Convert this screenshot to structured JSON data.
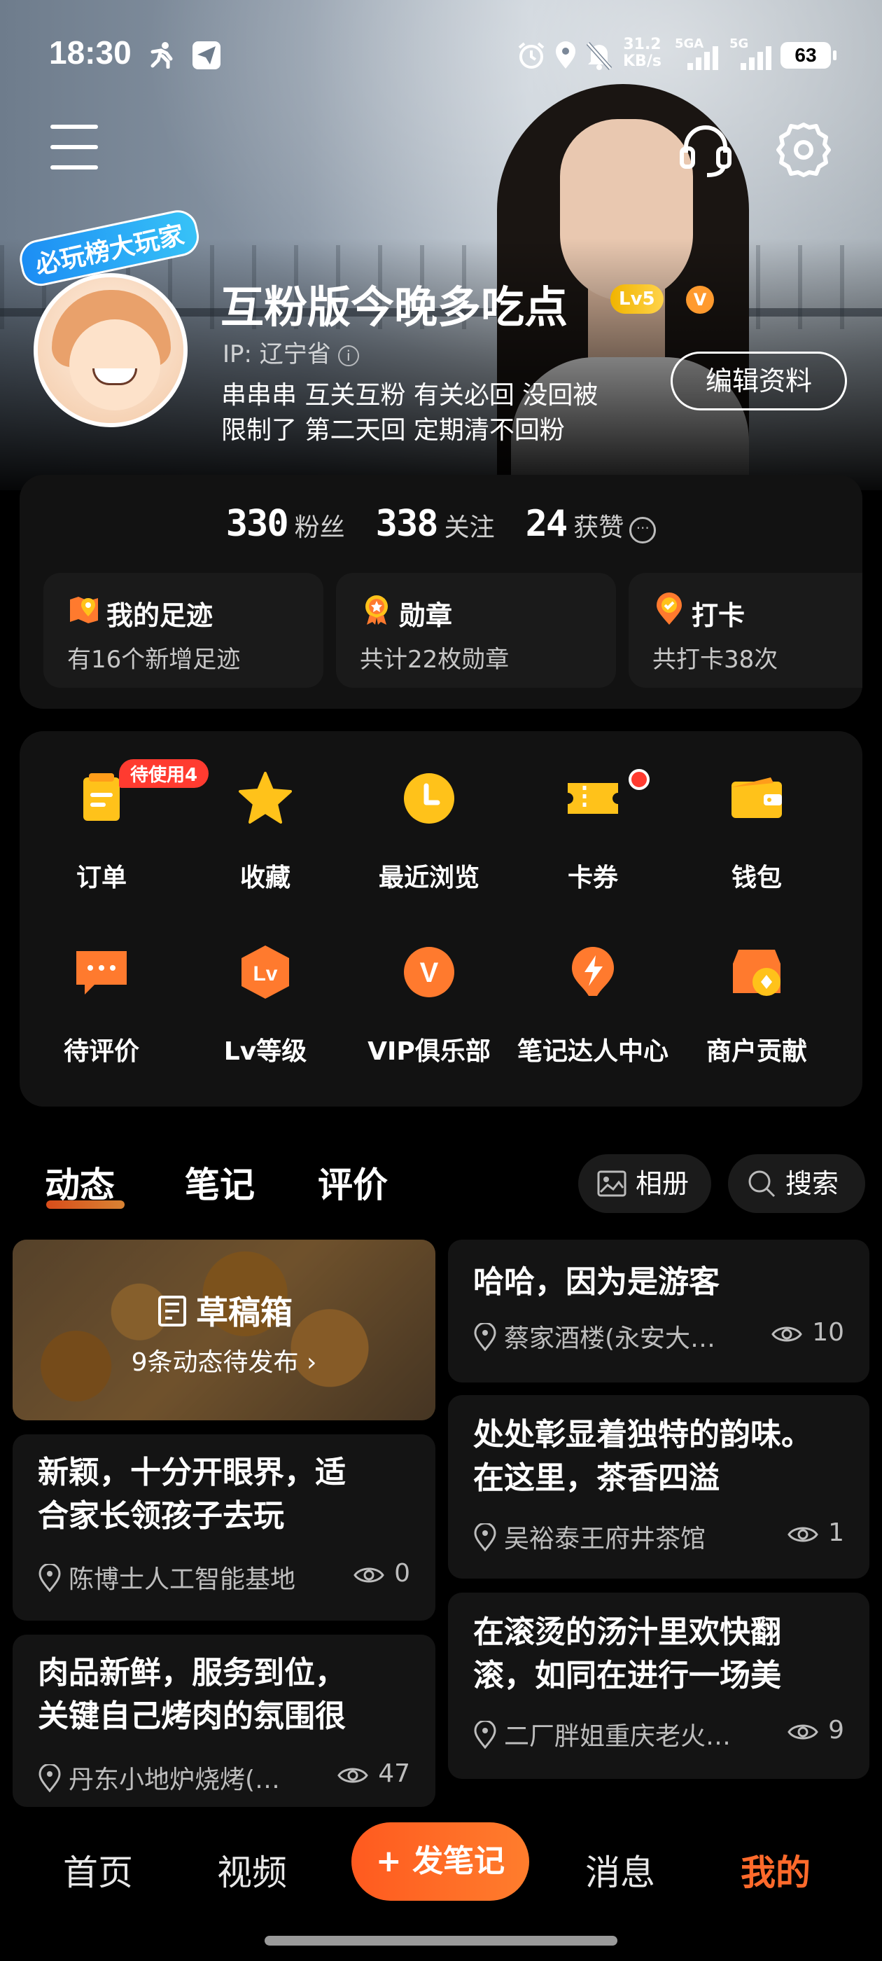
{
  "status_bar": {
    "time": "18:30",
    "speed_value": "31.2",
    "speed_unit": "KB/s",
    "network_1": "5GA",
    "network_2": "5G",
    "battery": "63"
  },
  "header_actions": {
    "menu_icon": "menu-icon",
    "support_icon": "headset-icon",
    "settings_icon": "gear-icon"
  },
  "profile": {
    "avatar_tag": "必玩榜大玩家",
    "nickname": "互粉版今晚多吃点",
    "level_badge": "Lv5",
    "vip_badge": "V",
    "ip_label": "IP: 辽宁省",
    "ip_info_icon": "i",
    "bio_line1": "串串串 互关互粉 有关必回 没回被",
    "bio_line2": "限制了 第二天回  定期清不回粉",
    "edit_button": "编辑资料"
  },
  "stats": {
    "followers_count": "330",
    "followers_label": "粉丝",
    "following_count": "338",
    "following_label": "关注",
    "likes_count": "24",
    "likes_label": "获赞",
    "more_icon": "···"
  },
  "quick_cards": [
    {
      "title": "我的足迹",
      "subtitle": "有16个新增足迹",
      "icon": "map-pin-icon"
    },
    {
      "title": "勋章",
      "subtitle": "共计22枚勋章",
      "icon": "medal-icon"
    },
    {
      "title": "打卡",
      "subtitle": "共打卡38次",
      "icon": "checkin-icon"
    }
  ],
  "services": {
    "row1": [
      {
        "label": "订单",
        "icon": "order-icon",
        "badge": "待使用4"
      },
      {
        "label": "收藏",
        "icon": "star-icon"
      },
      {
        "label": "最近浏览",
        "icon": "clock-icon"
      },
      {
        "label": "卡券",
        "icon": "coupon-icon"
      },
      {
        "label": "钱包",
        "icon": "wallet-icon"
      }
    ],
    "row2": [
      {
        "label": "待评价",
        "icon": "comment-icon"
      },
      {
        "label": "Lv等级",
        "icon": "level-icon"
      },
      {
        "label": "VIP俱乐部",
        "icon": "vip-icon"
      },
      {
        "label": "笔记达人中心",
        "icon": "flash-icon"
      },
      {
        "label": "商户贡献",
        "icon": "shop-icon"
      }
    ],
    "level_icon_text": "Lv",
    "vip_icon_text": "V"
  },
  "tabs": {
    "items": [
      "动态",
      "笔记",
      "评价"
    ],
    "active": "动态",
    "album_button": "相册",
    "search_button": "搜索"
  },
  "feed": {
    "draft_title": "草稿箱",
    "draft_subtitle": "9条动态待发布",
    "left": [
      {
        "title": "新颖，十分开眼界，适合家长领孩子去玩",
        "title_line1": "新颖，十分开眼界，适",
        "title_line2": "合家长领孩子去玩",
        "location": "陈博士人工智能基地",
        "views": "0"
      },
      {
        "title_line1": "肉品新鲜，服务到位，",
        "title_line2": "关键自己烤肉的氛围很",
        "location": "丹东小地炉烧烤(…",
        "views": "47"
      }
    ],
    "right": [
      {
        "title_line1": "哈哈，因为是游客",
        "location": "蔡家酒楼(永安大…",
        "views": "10"
      },
      {
        "title_line1": "处处彰显着独特的韵味。",
        "title_line2": "在这里，茶香四溢",
        "location": "吴裕泰王府井茶馆",
        "views": "1"
      },
      {
        "title_line1": "在滚烫的汤汁里欢快翻",
        "title_line2": "滚，如同在进行一场美",
        "location": "二厂胖姐重庆老火…",
        "views": "9"
      }
    ]
  },
  "bottom_nav": {
    "home": "首页",
    "video": "视频",
    "post": "+ 发笔记",
    "messages": "消息",
    "me": "我的"
  },
  "colors": {
    "accent": "#ff6a2b",
    "icon_yellow": "#ffc21a",
    "icon_orange": "#ff7a2e",
    "badge_red": "#ff3b30"
  }
}
